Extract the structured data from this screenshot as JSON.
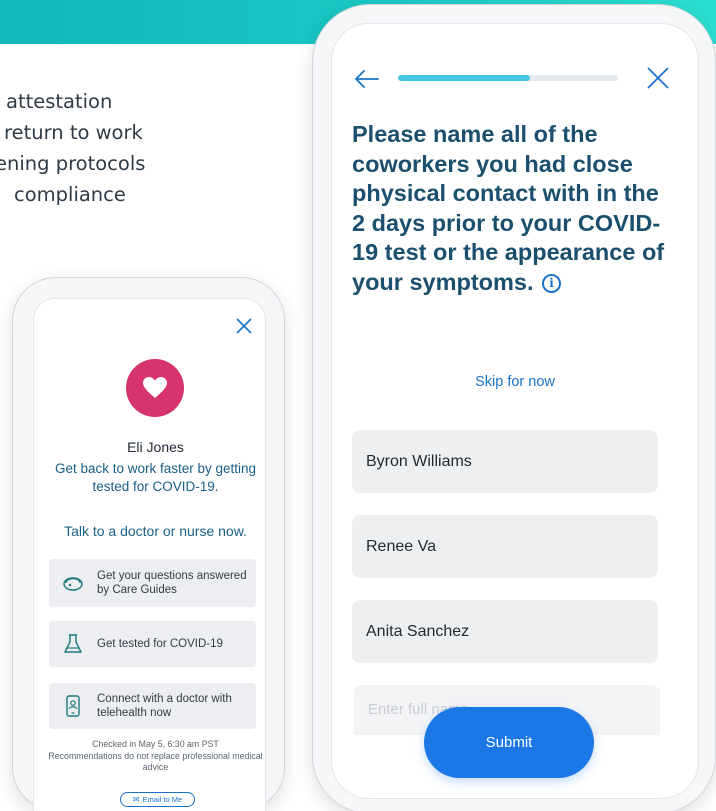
{
  "colors": {
    "banner_start": "#13b6b9",
    "banner_end": "#2adfd0",
    "accent_blue": "#1c78e6",
    "heading_blue": "#1a4f6e",
    "avatar_pink": "#d6336f"
  },
  "features": [
    "attestation",
    "return to work",
    "ening protocols",
    "compliance"
  ],
  "small_phone": {
    "avatar_icon": "heart-icon",
    "name": "Eli Jones",
    "headline": "Get back to work faster by getting tested for COVID-19.",
    "talk": "Talk to a doctor or nurse now.",
    "cards": [
      {
        "icon": "headset-icon",
        "label": "Get your questions answered by Care Guides"
      },
      {
        "icon": "flask-icon",
        "label": "Get tested for COVID-19"
      },
      {
        "icon": "phone-doctor-icon",
        "label": "Connect with a doctor with telehealth now"
      }
    ],
    "checked_in": "Checked in May 5, 6:30 am PST",
    "disclaimer": "Recommendations do not replace professional medical advice",
    "email_button": "Email to Me"
  },
  "large_phone": {
    "progress": 0.6,
    "question": "Please name all of the coworkers you had close physical contact with in the 2 days prior to your COVID-19 test or the appearance of your symptoms.",
    "info_symbol": "i",
    "skip": "Skip for now",
    "fields": [
      {
        "value": "Byron Williams"
      },
      {
        "value": "Renee Va"
      },
      {
        "value": "Anita Sanchez"
      }
    ],
    "empty_field_placeholder": "Enter full name",
    "submit": "Submit"
  }
}
